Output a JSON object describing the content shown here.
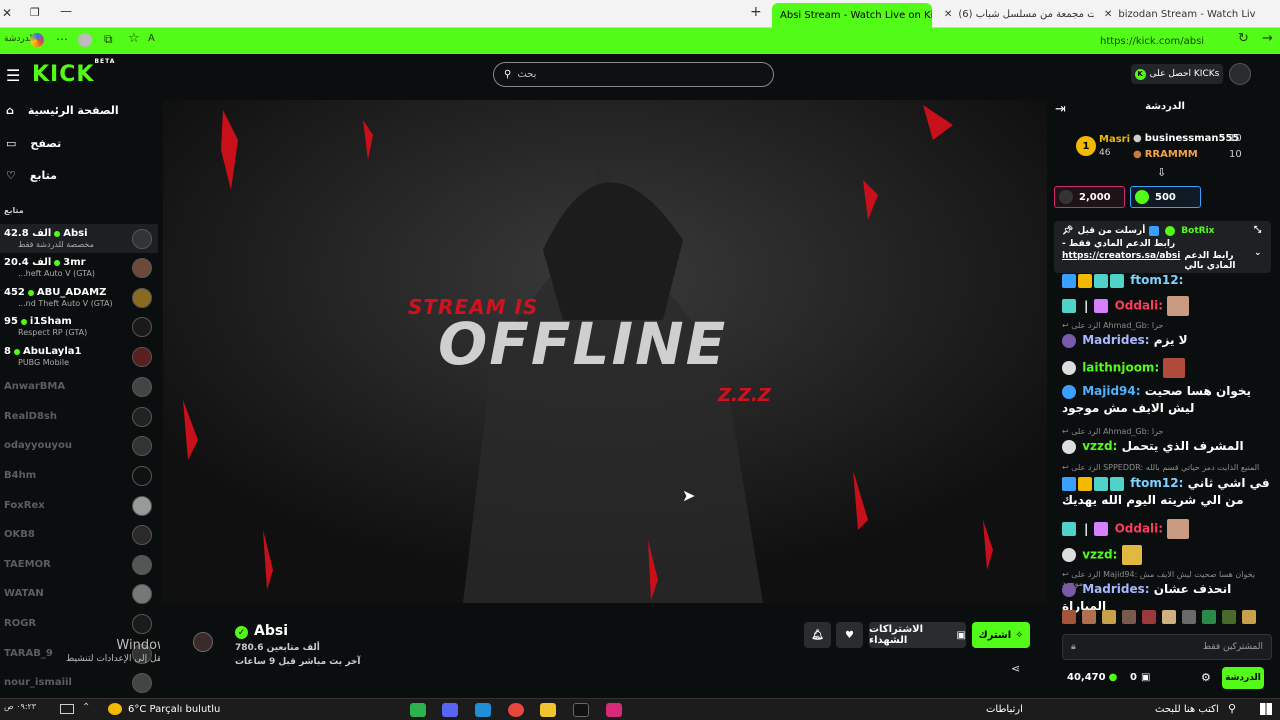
{
  "browser": {
    "tabs": [
      {
        "label": "bizodan Stream - Watch Live on K"
      },
      {
        "label": "(6) حلقات مجمعة من مسلسل شباب..."
      },
      {
        "label": "Absi Stream - Watch Live on Kick"
      }
    ],
    "url": "https://kick.com/absi",
    "left_label": "الدردشة"
  },
  "header": {
    "logo": "KICK",
    "beta": "BETA",
    "search_placeholder": "بحث",
    "kicks_button": "احصل على KICKs"
  },
  "sidebar": {
    "nav": [
      {
        "label": "الصفحة الرئيسية"
      },
      {
        "label": "تصفح"
      },
      {
        "label": "متابع"
      }
    ],
    "section_title": "متابع",
    "live_channels": [
      {
        "name": "Absi",
        "viewers": "42.8 ألف",
        "category": "مخصصة للدردشة فقط"
      },
      {
        "name": "3mr",
        "viewers": "20.4 ألف",
        "category": "...heft Auto V (GTA)"
      },
      {
        "name": "ABU_ADAMZ",
        "viewers": "452",
        "category": "...nd Theft Auto V (GTA)"
      },
      {
        "name": "i1Sham",
        "viewers": "95",
        "category": "Respect RP (GTA)"
      },
      {
        "name": "AbuLayla1",
        "viewers": "8",
        "category": "PUBG Mobile"
      }
    ],
    "offline_channels": [
      "AnwarBMA",
      "RealD8sh",
      "odayyouyou",
      "B4hm",
      "FoxRex",
      "OKB8",
      "TAEMOR",
      "WATAN",
      "ROGR",
      "TARAB_9",
      "nour_ismaiil"
    ]
  },
  "player": {
    "line1": "STREAM IS",
    "line2": "OFFLINE",
    "line3": "Z.Z.Z"
  },
  "channel": {
    "name": "Absi",
    "followers": "780.6 ألف متابعين",
    "last_live": "آخر بث مباشر قبل 9 ساعات",
    "subscribe_label": "اشترك",
    "gift_label": "الاشتراكات الشهداء"
  },
  "watermark": {
    "line1": "Windows تنشيط",
    "line2": "انتقل إلى الإعدادات لتنشيط Windows."
  },
  "chat": {
    "title": "الدردشة",
    "leaderboard": [
      {
        "rank": "1",
        "name": "Masri",
        "score": "46"
      },
      {
        "name": "businessman555",
        "score": "10"
      },
      {
        "name": "RRAMMM",
        "score": "10"
      }
    ],
    "goals": [
      "2,000",
      "500"
    ],
    "pinned": {
      "by": "أرسلت من قبل",
      "bot": "BotRix",
      "text": "- رابط الدعم المادي فقط",
      "link": "https://creators.sa/absi",
      "link_prefix": "رابط الدعم المادي بالي"
    },
    "messages": [
      {
        "user": "ftom12:",
        "text": "",
        "color": "#7fd3ff"
      },
      {
        "user": "Oddali:",
        "text": "",
        "color": "#ff3b5c"
      },
      {
        "reply": "الرد على Ahmad_Gb: حرا"
      },
      {
        "user": "Madrides:",
        "text": "لا يزم",
        "color": "#a8b8ff"
      },
      {
        "user": "laithnjoom:",
        "text": "",
        "color": "#53fc18"
      },
      {
        "user": "Majid94:",
        "text": "يخوان هسا صحيت ليش الايف مش موجود",
        "color": "#4fb3ff"
      },
      {
        "reply": "الرد على Ahmad_Gb: حرا"
      },
      {
        "user": "vzzd:",
        "text": "المشرف الذي يتحمل",
        "color": "#53fc18"
      },
      {
        "reply": "الرد على SPPEDDR: المنيع الذايت دمز حياتي قسم بالله"
      },
      {
        "user": "ftom12:",
        "text": "في اشي ثاني من الي شريته اليوم الله يهديك",
        "color": "#7fd3ff"
      },
      {
        "user": "Oddali:",
        "text": "",
        "color": "#ff3b5c"
      },
      {
        "user": "vzzd:",
        "text": "",
        "color": "#53fc18"
      },
      {
        "reply": "الرد على Majid94: يخوان هسا صحيت ليش الايف مش موجود"
      },
      {
        "user": "Madrides:",
        "text": "انحذف عشان المباراة",
        "color": "#a8b8ff"
      }
    ],
    "input_placeholder": "المشتركين فقط",
    "viewers": "40,470",
    "gifts": "0",
    "send_label": "الدردشة"
  },
  "taskbar": {
    "weather": "6°C  Parçalı bulutlu",
    "search": "اكتب هنا للبحث",
    "links": "ارتباطات",
    "time": "٠٩:٢٣ ص"
  }
}
